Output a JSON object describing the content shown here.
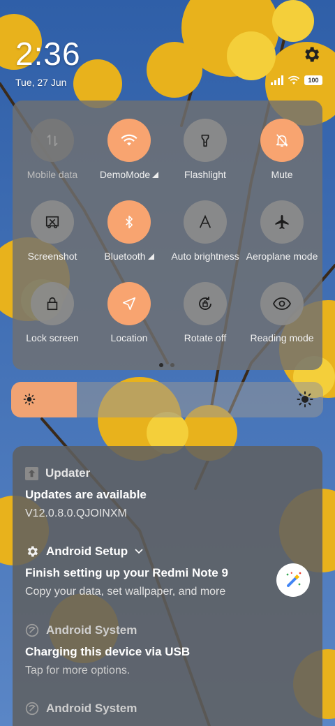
{
  "status_bar": {
    "time": "2:36",
    "date": "Tue, 27 Jun",
    "battery": "100"
  },
  "quick_settings": {
    "tiles": [
      {
        "label": "Mobile data",
        "icon": "mobile-data-icon",
        "state": "disabled"
      },
      {
        "label": "DemoMode",
        "icon": "wifi-icon",
        "state": "active",
        "expandable": true
      },
      {
        "label": "Flashlight",
        "icon": "flashlight-icon",
        "state": "off"
      },
      {
        "label": "Mute",
        "icon": "bell-off-icon",
        "state": "active"
      },
      {
        "label": "Screenshot",
        "icon": "screenshot-icon",
        "state": "off"
      },
      {
        "label": "Bluetooth",
        "icon": "bluetooth-icon",
        "state": "active",
        "expandable": true
      },
      {
        "label": "Auto brightness",
        "icon": "auto-brightness-icon",
        "state": "off"
      },
      {
        "label": "Aeroplane mode",
        "icon": "airplane-icon",
        "state": "off"
      },
      {
        "label": "Lock screen",
        "icon": "lock-icon",
        "state": "off"
      },
      {
        "label": "Location",
        "icon": "location-icon",
        "state": "active"
      },
      {
        "label": "Rotate off",
        "icon": "rotate-lock-icon",
        "state": "off"
      },
      {
        "label": "Reading mode",
        "icon": "eye-icon",
        "state": "off"
      }
    ],
    "page_count": 2,
    "current_page": 1
  },
  "brightness": {
    "level": 0.21
  },
  "notifications": [
    {
      "app": "Updater",
      "app_icon": "updater-icon",
      "title": "Updates are available",
      "text": "V12.0.8.0.QJOINXM"
    },
    {
      "app": "Android Setup",
      "app_icon": "gear-icon",
      "title": "Finish setting up your Redmi Note 9",
      "text": "Copy your data, set wallpaper, and more",
      "large_icon": "magic-wand-icon"
    },
    {
      "app": "Android System",
      "app_icon": "android-system-icon",
      "title": "Charging this device via USB",
      "text": "Tap for more options."
    },
    {
      "app": "Android System",
      "app_icon": "android-system-icon"
    }
  ],
  "colors": {
    "accent": "#f8a470",
    "panel": "#707070",
    "sky": "#3f6fb0",
    "leaves": "#e8b21c"
  }
}
